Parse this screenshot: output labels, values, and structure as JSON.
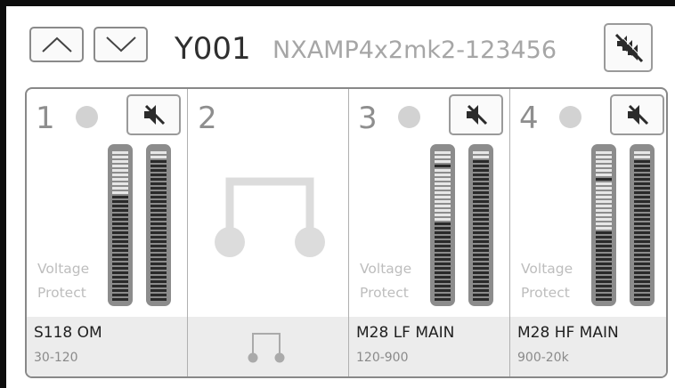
{
  "header": {
    "device_id": "Y001",
    "device_model": "NXAMP4x2mk2-123456"
  },
  "icons": {
    "up": "chevron-up-icon",
    "down": "chevron-down-icon",
    "mute_all": "mute-all-icon",
    "mute": "speaker-mute-icon",
    "bridge": "bridge-icon"
  },
  "channels": [
    {
      "number": "1",
      "name": "S118 OM",
      "range": "30-120",
      "warning_line1": "Voltage",
      "warning_line2": "Protect",
      "meter_a_level": 0.72,
      "meter_a_peak": 0.72,
      "meter_b_level": 0.95,
      "meter_b_peak": 0.44
    },
    {
      "number": "2",
      "bridged": true
    },
    {
      "number": "3",
      "name": "M28 LF MAIN",
      "range": "120-900",
      "warning_line1": "Voltage",
      "warning_line2": "Protect",
      "meter_a_level": 0.52,
      "meter_a_peak": 0.9,
      "meter_b_level": 0.95,
      "meter_b_peak": 0.47
    },
    {
      "number": "4",
      "name": "M28 HF MAIN",
      "range": "900-20k",
      "warning_line1": "Voltage",
      "warning_line2": "Protect",
      "meter_a_level": 0.46,
      "meter_a_peak": 0.81,
      "meter_b_level": 0.95,
      "meter_b_peak": 0.57
    }
  ],
  "colors": {
    "meter_lit": "#2a2a2a",
    "meter_unlit": "#e7e7e7",
    "meter_housing": "#8c8c8c",
    "led": "#d2d2d2",
    "footer_bg": "#ececec"
  }
}
